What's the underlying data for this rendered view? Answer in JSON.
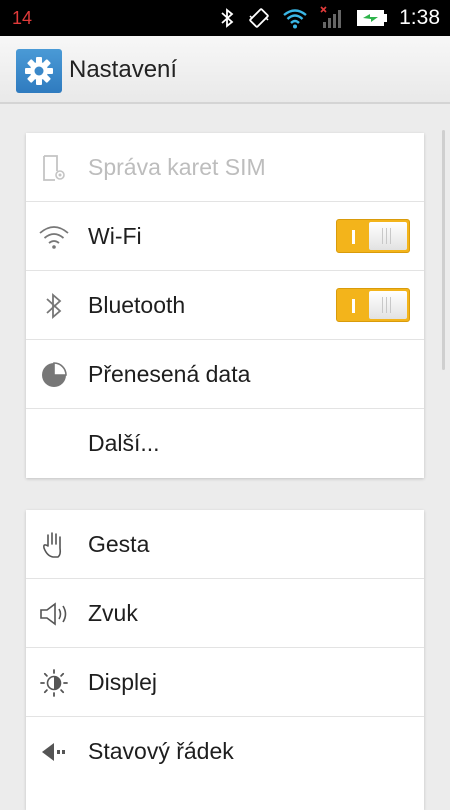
{
  "status_bar": {
    "notification_count": "14",
    "time": "1:38",
    "icons": [
      "bluetooth-icon",
      "vibrate-icon",
      "wifi-icon",
      "signal-icon",
      "battery-charging-icon"
    ]
  },
  "action_bar": {
    "title": "Nastavení",
    "icon": "settings-gear-icon"
  },
  "sections": [
    {
      "items": [
        {
          "label": "Správa karet SIM",
          "icon": "sim-icon",
          "enabled": false
        },
        {
          "label": "Wi-Fi",
          "icon": "wifi-icon",
          "toggle": true
        },
        {
          "label": "Bluetooth",
          "icon": "bluetooth-icon",
          "toggle": true
        },
        {
          "label": "Přenesená data",
          "icon": "data-usage-icon"
        },
        {
          "label": "Další...",
          "icon": ""
        }
      ]
    },
    {
      "items": [
        {
          "label": "Gesta",
          "icon": "hand-gesture-icon"
        },
        {
          "label": "Zvuk",
          "icon": "speaker-icon"
        },
        {
          "label": "Displej",
          "icon": "brightness-icon"
        },
        {
          "label": "Stavový řádek",
          "icon": "status-bar-icon"
        }
      ]
    }
  ],
  "colors": {
    "toggle_on": "#f3b41b",
    "notification": "#e03a3a",
    "app_icon": "#2f7bbf"
  }
}
